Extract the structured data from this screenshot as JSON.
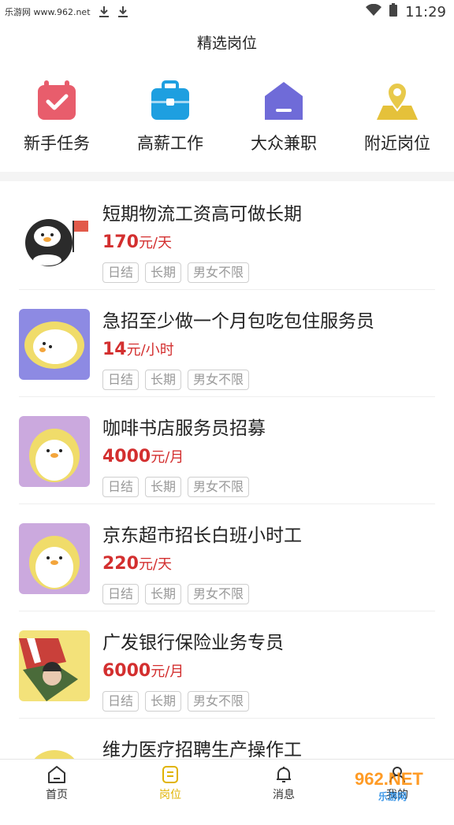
{
  "status_bar": {
    "site": "乐游网 www.962.net",
    "time": "11:29"
  },
  "header": {
    "title": "精选岗位"
  },
  "categories": [
    {
      "label": "新手任务",
      "icon": "calendar-check-icon",
      "color": "#e85d6c"
    },
    {
      "label": "高薪工作",
      "icon": "briefcase-icon",
      "color": "#1e9fe0"
    },
    {
      "label": "大众兼职",
      "icon": "house-icon",
      "color": "#6f6bd8"
    },
    {
      "label": "附近岗位",
      "icon": "location-map-icon",
      "color": "#e5c13a"
    }
  ],
  "jobs": [
    {
      "title": "短期物流工资高可做长期",
      "salary": "170",
      "unit": "元/天",
      "tags": [
        "日结",
        "长期",
        "男女不限"
      ]
    },
    {
      "title": "急招至少做一个月包吃包住服务员",
      "salary": "14",
      "unit": "元/小时",
      "tags": [
        "日结",
        "长期",
        "男女不限"
      ]
    },
    {
      "title": "咖啡书店服务员招募",
      "salary": "4000",
      "unit": "元/月",
      "tags": [
        "日结",
        "长期",
        "男女不限"
      ]
    },
    {
      "title": "京东超市招长白班小时工",
      "salary": "220",
      "unit": "元/天",
      "tags": [
        "日结",
        "长期",
        "男女不限"
      ]
    },
    {
      "title": "广发银行保险业务专员",
      "salary": "6000",
      "unit": "元/月",
      "tags": [
        "日结",
        "长期",
        "男女不限"
      ]
    },
    {
      "title": "维力医疗招聘生产操作工",
      "salary": "",
      "unit": "",
      "tags": []
    }
  ],
  "tabbar": {
    "items": [
      {
        "label": "首页",
        "icon": "home-icon"
      },
      {
        "label": "岗位",
        "icon": "list-icon"
      },
      {
        "label": "消息",
        "icon": "bell-icon"
      },
      {
        "label": "我的",
        "icon": "user-icon"
      }
    ],
    "active_color": "#e0b300"
  },
  "watermark": {
    "text": "962.NET",
    "sub": "乐游网"
  }
}
